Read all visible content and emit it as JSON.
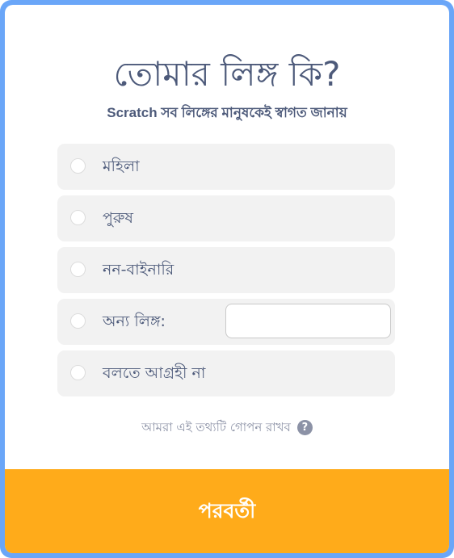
{
  "page": {
    "title": "তোমার লিঙ্গ কি?",
    "subtitle": "Scratch সব লিঙ্গের মানুষকেই স্বাগত জানায়"
  },
  "options": [
    {
      "label": "মহিলা"
    },
    {
      "label": "পুরুষ"
    },
    {
      "label": "নন-বাইনারি"
    },
    {
      "label": "অন্য লিঙ্গ:",
      "input_value": ""
    },
    {
      "label": "বলতে আগ্রহী না"
    }
  ],
  "privacy": {
    "text": "আমরা এই তথ্যটি গোপন রাখব",
    "icon": "?"
  },
  "next_button": {
    "label": "পরবর্তী"
  },
  "colors": {
    "frame": "#6aa6f8",
    "text": "#4d5a7a",
    "option_bg": "#f2f2f2",
    "muted": "#8c92a6",
    "next_button": "#ffab1a"
  }
}
